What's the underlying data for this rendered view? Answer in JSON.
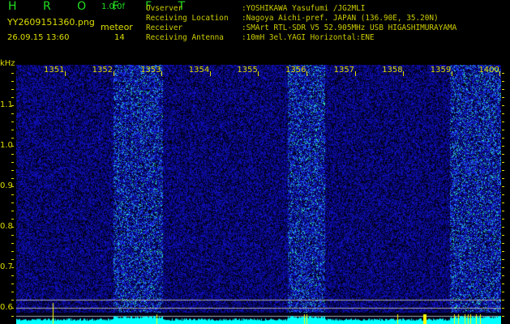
{
  "header": {
    "app_title": "H R O F F T",
    "version": "1.0.0f",
    "filename": "YY2609151360.png",
    "mode": "meteor",
    "datetime": "26.09.15 13:60",
    "count": "14"
  },
  "station_info": [
    {
      "label": "Ovserver",
      "value": ":YOSHIKAWA Yasufumi /JG2MLI"
    },
    {
      "label": "Receiving Location",
      "value": ":Nagoya Aichi-pref. JAPAN (136.90E, 35.20N)"
    },
    {
      "label": "Receiver",
      "value": ":SMArt RTL-SDR V5 52.905MHz USB HIGASHIMURAYAMA"
    },
    {
      "label": "Receiving Antenna",
      "value": ":10mH 3el.YAGI Horizontal:ENE"
    }
  ],
  "waterfall": {
    "y_unit": "kHz",
    "y_ticks": [
      "1.1",
      "1.0",
      "0.9",
      "0.8",
      "0.7",
      "0.6"
    ],
    "x_ticks": [
      "1351",
      "1352",
      "1353",
      "1354",
      "1355",
      "1356",
      "1357",
      "1358",
      "1359",
      "1400"
    ],
    "colors": {
      "noise": "#0000aa",
      "signal": "#00ffff",
      "label": "#dddd00",
      "spectrum": "#00ffff",
      "marker": "#ffff00",
      "gridline": "#aaaaaa"
    }
  }
}
